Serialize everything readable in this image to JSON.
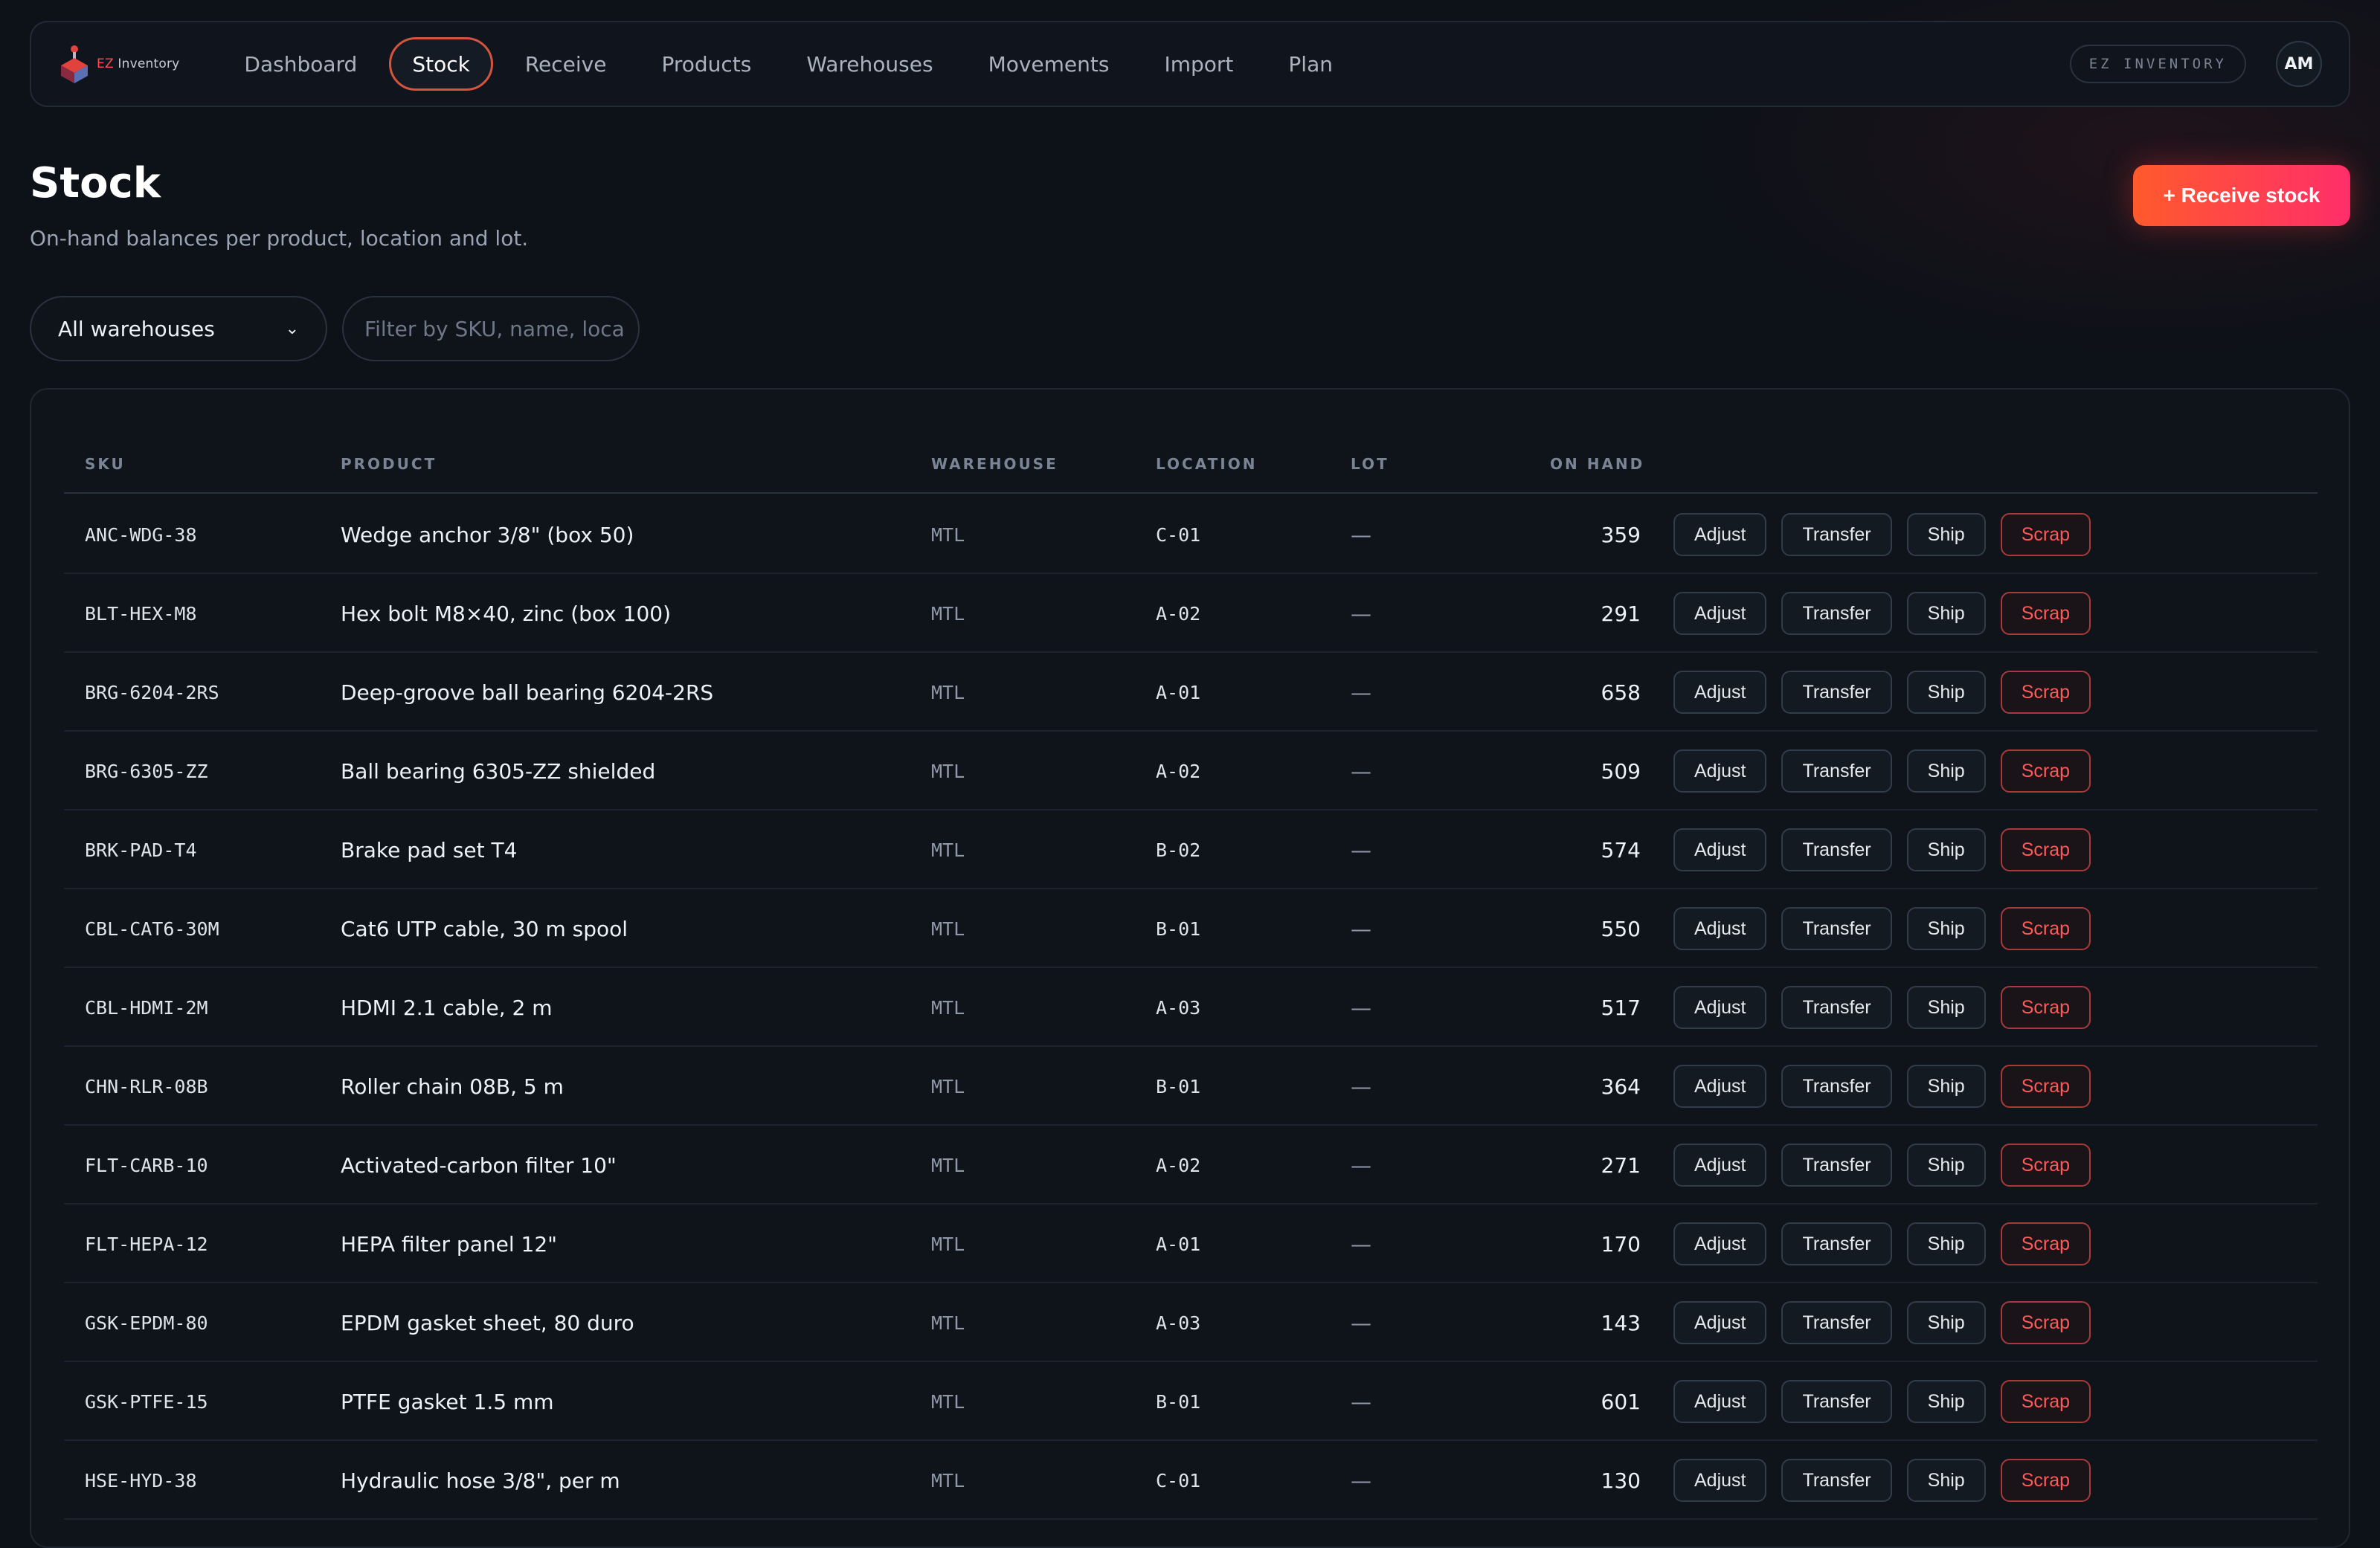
{
  "app": {
    "brand_prefix": "EZ",
    "brand_suffix": "Inventory",
    "badge": "EZ INVENTORY",
    "user_initials": "AM"
  },
  "nav": [
    {
      "label": "Dashboard",
      "active": false
    },
    {
      "label": "Stock",
      "active": true
    },
    {
      "label": "Receive",
      "active": false
    },
    {
      "label": "Products",
      "active": false
    },
    {
      "label": "Warehouses",
      "active": false
    },
    {
      "label": "Movements",
      "active": false
    },
    {
      "label": "Import",
      "active": false
    },
    {
      "label": "Plan",
      "active": false
    }
  ],
  "header": {
    "title": "Stock",
    "subtitle": "On-hand balances per product, location and lot.",
    "receive_label": "+ Receive stock"
  },
  "filters": {
    "warehouse_selected": "All warehouses",
    "search_placeholder": "Filter by SKU, name, loca"
  },
  "table": {
    "columns": [
      "SKU",
      "PRODUCT",
      "WAREHOUSE",
      "LOCATION",
      "LOT",
      "ON HAND"
    ],
    "actions": [
      "Adjust",
      "Transfer",
      "Ship",
      "Scrap"
    ],
    "rows": [
      {
        "sku": "ANC-WDG-38",
        "product": "Wedge anchor 3/8\" (box 50)",
        "warehouse": "MTL",
        "location": "C-01",
        "lot": "—",
        "on_hand": "359"
      },
      {
        "sku": "BLT-HEX-M8",
        "product": "Hex bolt M8×40, zinc (box 100)",
        "warehouse": "MTL",
        "location": "A-02",
        "lot": "—",
        "on_hand": "291"
      },
      {
        "sku": "BRG-6204-2RS",
        "product": "Deep-groove ball bearing 6204-2RS",
        "warehouse": "MTL",
        "location": "A-01",
        "lot": "—",
        "on_hand": "658"
      },
      {
        "sku": "BRG-6305-ZZ",
        "product": "Ball bearing 6305-ZZ shielded",
        "warehouse": "MTL",
        "location": "A-02",
        "lot": "—",
        "on_hand": "509"
      },
      {
        "sku": "BRK-PAD-T4",
        "product": "Brake pad set T4",
        "warehouse": "MTL",
        "location": "B-02",
        "lot": "—",
        "on_hand": "574"
      },
      {
        "sku": "CBL-CAT6-30M",
        "product": "Cat6 UTP cable, 30 m spool",
        "warehouse": "MTL",
        "location": "B-01",
        "lot": "—",
        "on_hand": "550"
      },
      {
        "sku": "CBL-HDMI-2M",
        "product": "HDMI 2.1 cable, 2 m",
        "warehouse": "MTL",
        "location": "A-03",
        "lot": "—",
        "on_hand": "517"
      },
      {
        "sku": "CHN-RLR-08B",
        "product": "Roller chain 08B, 5 m",
        "warehouse": "MTL",
        "location": "B-01",
        "lot": "—",
        "on_hand": "364"
      },
      {
        "sku": "FLT-CARB-10",
        "product": "Activated-carbon filter 10\"",
        "warehouse": "MTL",
        "location": "A-02",
        "lot": "—",
        "on_hand": "271"
      },
      {
        "sku": "FLT-HEPA-12",
        "product": "HEPA filter panel 12\"",
        "warehouse": "MTL",
        "location": "A-01",
        "lot": "—",
        "on_hand": "170"
      },
      {
        "sku": "GSK-EPDM-80",
        "product": "EPDM gasket sheet, 80 duro",
        "warehouse": "MTL",
        "location": "A-03",
        "lot": "—",
        "on_hand": "143"
      },
      {
        "sku": "GSK-PTFE-15",
        "product": "PTFE gasket 1.5 mm",
        "warehouse": "MTL",
        "location": "B-01",
        "lot": "—",
        "on_hand": "601"
      },
      {
        "sku": "HSE-HYD-38",
        "product": "Hydraulic hose 3/8\", per m",
        "warehouse": "MTL",
        "location": "C-01",
        "lot": "—",
        "on_hand": "130"
      }
    ]
  },
  "colors": {
    "accent": "#d4553b",
    "cta_start": "#ff5a2c",
    "cta_end": "#ff2e6a",
    "scrap": "#ff5a5a",
    "background": "#0d1118"
  }
}
